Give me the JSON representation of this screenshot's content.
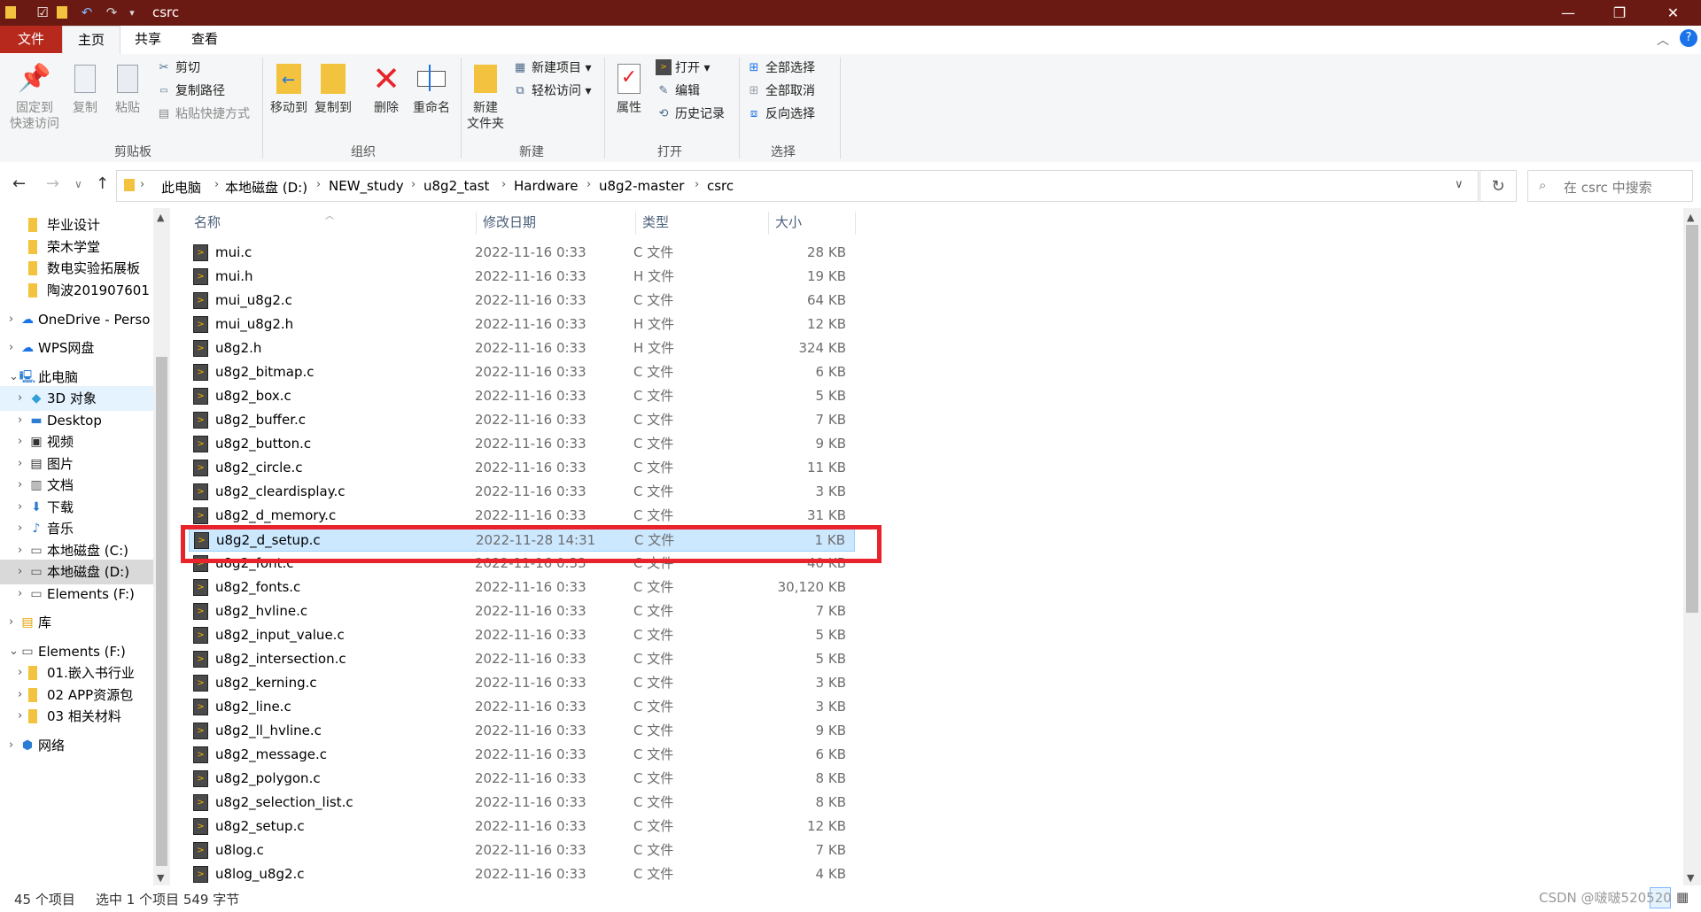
{
  "window": {
    "title": "csrc",
    "controls": {
      "minimize": "—",
      "maximize": "❐",
      "close": "✕"
    }
  },
  "ribbon_tabs": [
    "文件",
    "主页",
    "共享",
    "查看"
  ],
  "ribbon": {
    "clipboard": {
      "pin_label_1": "固定到",
      "pin_label_2": "快速访问",
      "copy_label": "复制",
      "paste_label": "粘贴",
      "cut_label": "剪切",
      "copy_path_label": "复制路径",
      "paste_shortcut_label": "粘贴快捷方式",
      "group_name": "剪贴板"
    },
    "organize": {
      "move_to_label": "移动到",
      "copy_to_label": "复制到",
      "delete_label": "删除",
      "rename_label": "重命名",
      "group_name": "组织"
    },
    "new": {
      "new_folder_label_1": "新建",
      "new_folder_label_2": "文件夹",
      "new_item_label": "新建项目 ▾",
      "easy_access_label": "轻松访问 ▾",
      "group_name": "新建"
    },
    "open": {
      "properties_label": "属性",
      "open_label": "打开 ▾",
      "edit_label": "编辑",
      "history_label": "历史记录",
      "group_name": "打开"
    },
    "select": {
      "select_all_label": "全部选择",
      "select_none_label": "全部取消",
      "invert_label": "反向选择",
      "group_name": "选择"
    }
  },
  "address": {
    "breadcrumbs": [
      "此电脑",
      "本地磁盘 (D:)",
      "NEW_study",
      "u8g2_tast",
      "Hardware",
      "u8g2-master",
      "csrc"
    ],
    "search_placeholder": "在 csrc 中搜索"
  },
  "nav_pane": [
    {
      "label": "毕业设计",
      "icon": "folder-icon"
    },
    {
      "label": "荣木学堂",
      "icon": "folder-icon"
    },
    {
      "label": "数电实验拓展板",
      "icon": "folder-icon"
    },
    {
      "label": "陶波201907601",
      "icon": "folder-icon"
    },
    {
      "label": "OneDrive - Perso",
      "icon": "cloud-icon"
    },
    {
      "label": "WPS网盘",
      "icon": "cloud-icon"
    },
    {
      "label": "此电脑",
      "icon": "computer-icon"
    },
    {
      "label": "3D 对象",
      "icon": "cube-icon"
    },
    {
      "label": "Desktop",
      "icon": "desktop-icon"
    },
    {
      "label": "视频",
      "icon": "video-icon"
    },
    {
      "label": "图片",
      "icon": "picture-icon"
    },
    {
      "label": "文档",
      "icon": "document-icon"
    },
    {
      "label": "下载",
      "icon": "download-icon"
    },
    {
      "label": "音乐",
      "icon": "music-icon"
    },
    {
      "label": "本地磁盘 (C:)",
      "icon": "drive-icon"
    },
    {
      "label": "本地磁盘 (D:)",
      "icon": "drive-icon"
    },
    {
      "label": "Elements (F:)",
      "icon": "drive-icon"
    },
    {
      "label": "库",
      "icon": "library-icon"
    },
    {
      "label": "Elements (F:)",
      "icon": "drive-icon"
    },
    {
      "label": "01.嵌入书行业",
      "icon": "folder-icon"
    },
    {
      "label": "02  APP资源包",
      "icon": "folder-icon"
    },
    {
      "label": "03  相关材料",
      "icon": "folder-icon"
    },
    {
      "label": "网络",
      "icon": "network-icon"
    }
  ],
  "columns": {
    "name": "名称",
    "date": "修改日期",
    "type": "类型",
    "size": "大小"
  },
  "files": [
    {
      "name": "mui.c",
      "date": "2022-11-16 0:33",
      "type": "C 文件",
      "size": "28 KB"
    },
    {
      "name": "mui.h",
      "date": "2022-11-16 0:33",
      "type": "H 文件",
      "size": "19 KB"
    },
    {
      "name": "mui_u8g2.c",
      "date": "2022-11-16 0:33",
      "type": "C 文件",
      "size": "64 KB"
    },
    {
      "name": "mui_u8g2.h",
      "date": "2022-11-16 0:33",
      "type": "H 文件",
      "size": "12 KB"
    },
    {
      "name": "u8g2.h",
      "date": "2022-11-16 0:33",
      "type": "H 文件",
      "size": "324 KB"
    },
    {
      "name": "u8g2_bitmap.c",
      "date": "2022-11-16 0:33",
      "type": "C 文件",
      "size": "6 KB"
    },
    {
      "name": "u8g2_box.c",
      "date": "2022-11-16 0:33",
      "type": "C 文件",
      "size": "5 KB"
    },
    {
      "name": "u8g2_buffer.c",
      "date": "2022-11-16 0:33",
      "type": "C 文件",
      "size": "7 KB"
    },
    {
      "name": "u8g2_button.c",
      "date": "2022-11-16 0:33",
      "type": "C 文件",
      "size": "9 KB"
    },
    {
      "name": "u8g2_circle.c",
      "date": "2022-11-16 0:33",
      "type": "C 文件",
      "size": "11 KB"
    },
    {
      "name": "u8g2_cleardisplay.c",
      "date": "2022-11-16 0:33",
      "type": "C 文件",
      "size": "3 KB"
    },
    {
      "name": "u8g2_d_memory.c",
      "date": "2022-11-16 0:33",
      "type": "C 文件",
      "size": "31 KB"
    },
    {
      "name": "u8g2_d_setup.c",
      "date": "2022-11-28 14:31",
      "type": "C 文件",
      "size": "1 KB"
    },
    {
      "name": "u8g2_font.c",
      "date": "2022-11-16 0:33",
      "type": "C 文件",
      "size": "40 KB"
    },
    {
      "name": "u8g2_fonts.c",
      "date": "2022-11-16 0:33",
      "type": "C 文件",
      "size": "30,120 KB"
    },
    {
      "name": "u8g2_hvline.c",
      "date": "2022-11-16 0:33",
      "type": "C 文件",
      "size": "7 KB"
    },
    {
      "name": "u8g2_input_value.c",
      "date": "2022-11-16 0:33",
      "type": "C 文件",
      "size": "5 KB"
    },
    {
      "name": "u8g2_intersection.c",
      "date": "2022-11-16 0:33",
      "type": "C 文件",
      "size": "5 KB"
    },
    {
      "name": "u8g2_kerning.c",
      "date": "2022-11-16 0:33",
      "type": "C 文件",
      "size": "3 KB"
    },
    {
      "name": "u8g2_line.c",
      "date": "2022-11-16 0:33",
      "type": "C 文件",
      "size": "3 KB"
    },
    {
      "name": "u8g2_ll_hvline.c",
      "date": "2022-11-16 0:33",
      "type": "C 文件",
      "size": "9 KB"
    },
    {
      "name": "u8g2_message.c",
      "date": "2022-11-16 0:33",
      "type": "C 文件",
      "size": "6 KB"
    },
    {
      "name": "u8g2_polygon.c",
      "date": "2022-11-16 0:33",
      "type": "C 文件",
      "size": "8 KB"
    },
    {
      "name": "u8g2_selection_list.c",
      "date": "2022-11-16 0:33",
      "type": "C 文件",
      "size": "8 KB"
    },
    {
      "name": "u8g2_setup.c",
      "date": "2022-11-16 0:33",
      "type": "C 文件",
      "size": "12 KB"
    },
    {
      "name": "u8log.c",
      "date": "2022-11-16 0:33",
      "type": "C 文件",
      "size": "7 KB"
    },
    {
      "name": "u8log_u8g2.c",
      "date": "2022-11-16 0:33",
      "type": "C 文件",
      "size": "4 KB"
    }
  ],
  "selected_file": "u8g2_d_setup.c",
  "status": {
    "item_count": "45 个项目",
    "selection": "选中 1 个项目  549 字节"
  },
  "watermark": "CSDN @啵啵520520",
  "colors": {
    "titlebar": "#6a1a12",
    "file_tab": "#b7291d",
    "selection": "#cce8ff",
    "highlight_box": "#e8232b"
  }
}
